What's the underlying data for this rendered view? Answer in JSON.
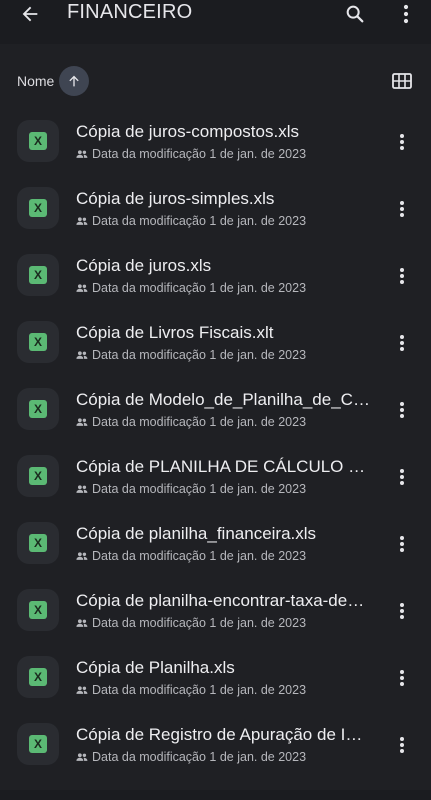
{
  "header": {
    "title": "FINANCEIRO"
  },
  "sort": {
    "label": "Nome"
  },
  "files": [
    {
      "name": "Cópia de juros-compostos.xls",
      "meta": "Data da modificação 1 de jan. de 2023",
      "icon": "xls-icon",
      "icon_letter": "X"
    },
    {
      "name": "Cópia de juros-simples.xls",
      "meta": "Data da modificação 1 de jan. de 2023",
      "icon": "xls-icon",
      "icon_letter": "X"
    },
    {
      "name": "Cópia de juros.xls",
      "meta": "Data da modificação 1 de jan. de 2023",
      "icon": "xls-icon",
      "icon_letter": "X"
    },
    {
      "name": "Cópia de Livros Fiscais.xlt",
      "meta": "Data da modificação 1 de jan. de 2023",
      "icon": "xls-icon",
      "icon_letter": "X"
    },
    {
      "name": "Cópia de Modelo_de_Planilha_de_Cál…",
      "meta": "Data da modificação 1 de jan. de 2023",
      "icon": "xls-icon",
      "icon_letter": "X"
    },
    {
      "name": "Cópia de PLANILHA DE CÁLCULO D…",
      "meta": "Data da modificação 1 de jan. de 2023",
      "icon": "xls-icon",
      "icon_letter": "X"
    },
    {
      "name": "Cópia de planilha_financeira.xls",
      "meta": "Data da modificação 1 de jan. de 2023",
      "icon": "xls-icon",
      "icon_letter": "X"
    },
    {
      "name": "Cópia de planilha-encontrar-taxa-de…",
      "meta": "Data da modificação 1 de jan. de 2023",
      "icon": "xls-icon",
      "icon_letter": "X"
    },
    {
      "name": "Cópia de Planilha.xls",
      "meta": "Data da modificação 1 de jan. de 2023",
      "icon": "xls-icon",
      "icon_letter": "X"
    },
    {
      "name": "Cópia de Registro de Apuração de I…",
      "meta": "Data da modificação 1 de jan. de 2023",
      "icon": "xls-icon",
      "icon_letter": "X"
    }
  ],
  "colors": {
    "background": "#1f2024",
    "accent_green": "#5bb974",
    "sort_chip": "#3f4552"
  }
}
